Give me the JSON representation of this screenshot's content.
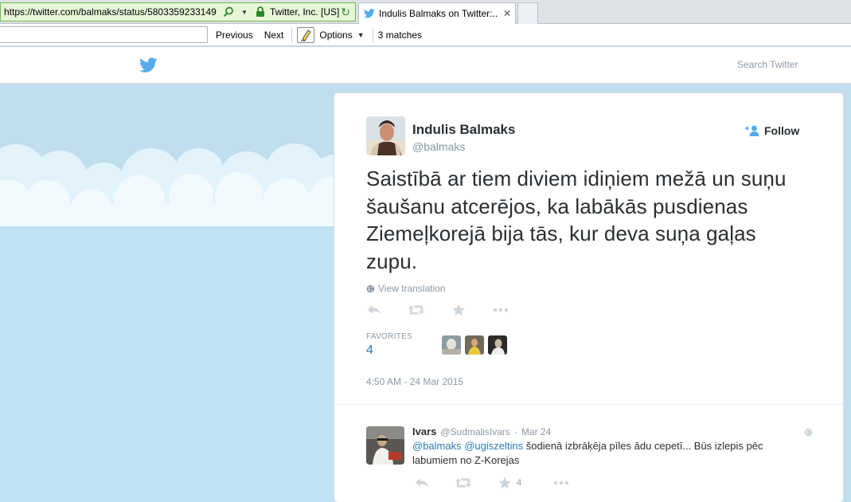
{
  "browser": {
    "url": "https://twitter.com/balmaks/status/5803359233149",
    "site_identity": "Twitter, Inc. [US]",
    "tab_title": "Indulis Balmaks on Twitter:..."
  },
  "find_bar": {
    "previous_label": "Previous",
    "next_label": "Next",
    "options_label": "Options",
    "matches_label": "3 matches"
  },
  "header": {
    "search_placeholder": "Search Twitter"
  },
  "tweet": {
    "fullname": "Indulis Balmaks",
    "screenname": "@balmaks",
    "follow_label": "Follow",
    "text": "Saistībā ar tiem diviem idiņiem mežā un suņu šaušanu atcerējos, ka labākās pusdienas Ziemeļkorejā bija tās, kur deva suņa gaļas zupu.",
    "view_translation": "View translation",
    "favorites_label": "FAVORITES",
    "favorites_count": "4",
    "timestamp": "4:50 AM - 24 Mar 2015"
  },
  "reply": {
    "name": "Ivars",
    "handle": "@SudmalisIvars",
    "separator": "·",
    "time": "Mar 24",
    "mention1": "@balmaks",
    "mention2": "@ugiszeltins",
    "text": " šodienā izbrāķēja pīles ādu cepetī... Būs izlepis pēc labumiem no Z-Korejas",
    "favorite_count": "4"
  },
  "colors": {
    "link_blue": "#2b7bb9",
    "twitter_blue": "#55acee",
    "muted_gray": "#8899a6",
    "sky_blue": "#c0deed"
  }
}
